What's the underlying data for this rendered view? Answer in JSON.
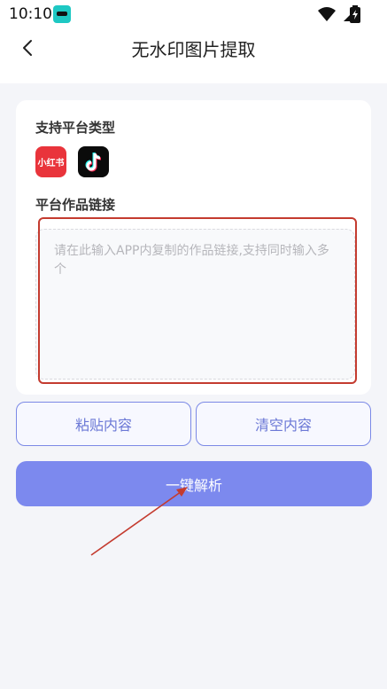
{
  "status_bar": {
    "time": "10:10"
  },
  "header": {
    "title": "无水印图片提取"
  },
  "card": {
    "platform_label": "支持平台类型",
    "platforms": [
      {
        "name": "小红书",
        "icon": "xiaohongshu-icon",
        "color": "#e9343b"
      },
      {
        "name": "",
        "icon": "douyin-icon",
        "color": "#0b0b0b"
      }
    ],
    "link_label": "平台作品链接",
    "link_input": {
      "value": "",
      "placeholder": "请在此输入APP内复制的作品链接,支持同时输入多个"
    }
  },
  "buttons": {
    "paste": "粘贴内容",
    "clear": "清空内容",
    "parse": "一键解析"
  },
  "colors": {
    "accent": "#7c89ee",
    "outline": "#7b89e6",
    "annotation": "#c43b2f"
  }
}
